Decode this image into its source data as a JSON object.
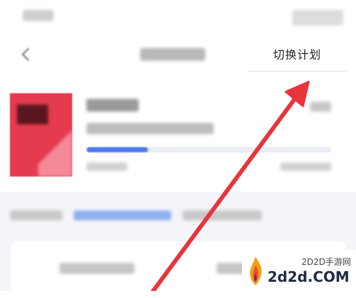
{
  "nav": {
    "back_icon": "chevron-left-icon",
    "switch_plan_label": "切换计划"
  },
  "book": {
    "progress_percent": 25,
    "progress_color": "#4a7ae8",
    "cover_color": "#e63b4f"
  },
  "plan_info": {
    "date_color": "#4a7ae8"
  },
  "annotation": {
    "arrow_color": "#e8343c"
  },
  "watermark": {
    "site_cn": "2D2D手游网",
    "domain": "2d2d.COM",
    "logo_icon": "flame-icon"
  }
}
